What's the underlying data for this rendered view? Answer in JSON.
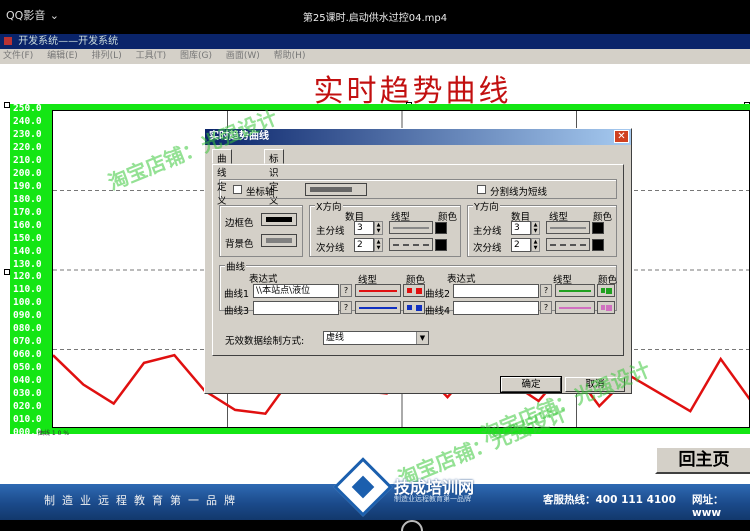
{
  "player": {
    "logo": "QQ影音",
    "menu_glyph": "⌄",
    "video_title": "第25课时.启动供水过控04.mp4"
  },
  "app": {
    "caption": "开发系统——开发系统",
    "menu": [
      "文件(F)",
      "编辑(E)",
      "排列(L)",
      "工具(T)",
      "图库(G)",
      "画面(W)",
      "帮助(H)"
    ],
    "big_title": "实时趋势曲线",
    "back_button": "回主页"
  },
  "chart_data": {
    "type": "line",
    "y_ticks": [
      "250.0",
      "240.0",
      "230.0",
      "220.0",
      "210.0",
      "200.0",
      "190.0",
      "180.0",
      "170.0",
      "160.0",
      "150.0",
      "140.0",
      "130.0",
      "120.0",
      "110.0",
      "100.0",
      "090.0",
      "080.0",
      "070.0",
      "060.0",
      "050.0",
      "040.0",
      "030.0",
      "020.0",
      "010.0",
      "000.0"
    ],
    "ylim": [
      0,
      250
    ],
    "x_caption": "曲线 1  0 %",
    "grid": true,
    "series": [
      {
        "color": "#e01010",
        "x": [
          0,
          1,
          2,
          3,
          4,
          5,
          6,
          7,
          8,
          9,
          10,
          11,
          12,
          13,
          14,
          15,
          16,
          17,
          18,
          19,
          20,
          21,
          22,
          23
        ],
        "y": [
          58,
          35,
          20,
          52,
          58,
          30,
          15,
          12,
          45,
          55,
          30,
          28,
          50,
          25,
          52,
          38,
          22,
          50,
          18,
          42,
          28,
          14,
          55,
          22
        ]
      }
    ]
  },
  "dialog": {
    "title": "实时趋势曲线",
    "close_glyph": "✕",
    "tabs": [
      "曲线定义",
      "标识定义"
    ],
    "coord_axis_label": "坐标轴",
    "split_label": "分割线为短线",
    "border_color_label": "边框色",
    "bg_color_label": "背景色",
    "x_group_title": "X方向",
    "y_group_title": "Y方向",
    "count_label": "数目",
    "linetype_label": "线型",
    "color_label": "颜色",
    "major_label": "主分线",
    "minor_label": "次分线",
    "x_major_count": "3",
    "x_minor_count": "2",
    "y_major_count": "3",
    "y_minor_count": "2",
    "curves_group_title": "曲线",
    "expr_label": "表达式",
    "curve1_label": "曲线1",
    "curve2_label": "曲线2",
    "curve3_label": "曲线3",
    "curve4_label": "曲线4",
    "curve1_expr": "\\\\本站点\\液位",
    "curve2_expr": "",
    "curve3_expr": "",
    "curve4_expr": "",
    "question_glyph": "?",
    "invalid_draw_label": "无效数据绘制方式:",
    "invalid_draw_value": "虚线",
    "ok_label": "确定",
    "cancel_label": "取消",
    "colors": {
      "curve1": "#e01010",
      "curve2": "#1030c0",
      "curve3": "#20a020",
      "curve4": "#d070c0"
    }
  },
  "watermarks": {
    "shop": "淘宝店铺：光强设计"
  },
  "footer": {
    "slogan": "制造业远程教育第一品牌",
    "brand": "技成培训网",
    "brand_sub": "制造业远程教育第一品牌",
    "hotline": "客服热线：400 111 4100",
    "site": "网址：www"
  }
}
